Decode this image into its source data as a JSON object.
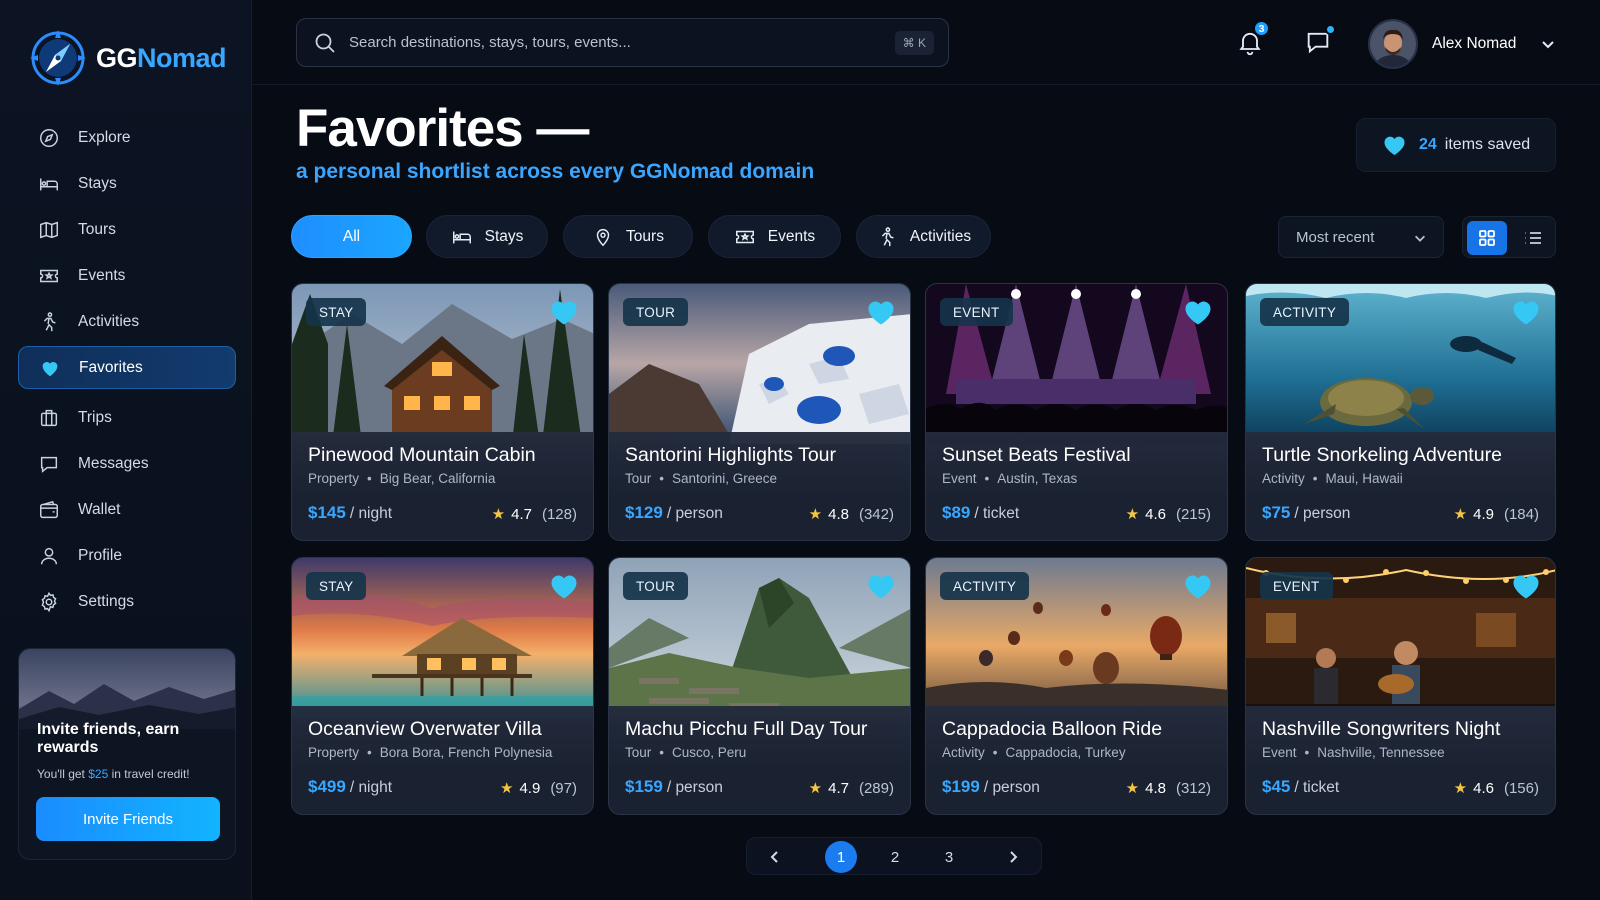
{
  "brand": {
    "name_part1": "GG",
    "name_part2": "Nomad"
  },
  "sidebar": {
    "items": [
      {
        "label": "Explore",
        "icon": "compass-icon"
      },
      {
        "label": "Stays",
        "icon": "bed-icon"
      },
      {
        "label": "Tours",
        "icon": "map-icon"
      },
      {
        "label": "Events",
        "icon": "ticket-icon"
      },
      {
        "label": "Activities",
        "icon": "running-person-icon"
      },
      {
        "label": "Favorites",
        "icon": "heart-icon",
        "active": true
      },
      {
        "label": "Trips",
        "icon": "suitcase-icon"
      },
      {
        "label": "Messages",
        "icon": "chat-icon"
      },
      {
        "label": "Wallet",
        "icon": "wallet-icon"
      },
      {
        "label": "Profile",
        "icon": "user-icon"
      },
      {
        "label": "Settings",
        "icon": "gear-icon"
      }
    ],
    "invite": {
      "title": "Invite friends, earn rewards",
      "sub_prefix": "You'll get ",
      "sub_amount": "$25",
      "sub_suffix": " in travel credit!",
      "button": "Invite Friends"
    }
  },
  "topbar": {
    "search_placeholder": "Search destinations, stays, tours, events...",
    "shortcut": "⌘ K",
    "notifications_count": "3",
    "user_name": "Alex Nomad"
  },
  "header": {
    "title": "Favorites —",
    "subtitle": "a personal shortlist across every GGNomad domain",
    "saved_count": "24",
    "saved_label": "items saved"
  },
  "filters": {
    "chips": [
      {
        "label": "All",
        "icon": "",
        "active": true
      },
      {
        "label": "Stays",
        "icon": "bed-icon"
      },
      {
        "label": "Tours",
        "icon": "location-pin-icon"
      },
      {
        "label": "Events",
        "icon": "ticket-icon"
      },
      {
        "label": "Activities",
        "icon": "running-person-icon"
      }
    ],
    "sort": "Most recent"
  },
  "cards": [
    {
      "tag": "STAY",
      "title": "Pinewood Mountain Cabin",
      "category": "Property",
      "location": "Big Bear, California",
      "price": "$145",
      "unit": "/ night",
      "rating": "4.7",
      "reviews": "(128)",
      "image": "cabin"
    },
    {
      "tag": "TOUR",
      "title": "Santorini Highlights Tour",
      "category": "Tour",
      "location": "Santorini, Greece",
      "price": "$129",
      "unit": "/ person",
      "rating": "4.8",
      "reviews": "(342)",
      "image": "santorini"
    },
    {
      "tag": "EVENT",
      "title": "Sunset Beats Festival",
      "category": "Event",
      "location": "Austin, Texas",
      "price": "$89",
      "unit": "/ ticket",
      "rating": "4.6",
      "reviews": "(215)",
      "image": "concert"
    },
    {
      "tag": "ACTIVITY",
      "title": "Turtle Snorkeling Adventure",
      "category": "Activity",
      "location": "Maui, Hawaii",
      "price": "$75",
      "unit": "/ person",
      "rating": "4.9",
      "reviews": "(184)",
      "image": "ocean"
    },
    {
      "tag": "STAY",
      "title": "Oceanview Overwater Villa",
      "category": "Property",
      "location": "Bora Bora, French Polynesia",
      "price": "$499",
      "unit": "/ night",
      "rating": "4.9",
      "reviews": "(97)",
      "image": "villa"
    },
    {
      "tag": "TOUR",
      "title": "Machu Picchu Full Day Tour",
      "category": "Tour",
      "location": "Cusco, Peru",
      "price": "$159",
      "unit": "/ person",
      "rating": "4.7",
      "reviews": "(289)",
      "image": "machu"
    },
    {
      "tag": "ACTIVITY",
      "title": "Cappadocia Balloon Ride",
      "category": "Activity",
      "location": "Cappadocia, Turkey",
      "price": "$199",
      "unit": "/ person",
      "rating": "4.8",
      "reviews": "(312)",
      "image": "balloons"
    },
    {
      "tag": "EVENT",
      "title": "Nashville Songwriters Night",
      "category": "Event",
      "location": "Nashville, Tennessee",
      "price": "$45",
      "unit": "/ ticket",
      "rating": "4.6",
      "reviews": "(156)",
      "image": "bar"
    }
  ],
  "pagination": {
    "pages": [
      "1",
      "2",
      "3"
    ],
    "current": "1"
  },
  "colors": {
    "accent": "#38a7ff",
    "favorite": "#35c8f5",
    "star": "#f5c542",
    "background": "#070b14"
  }
}
